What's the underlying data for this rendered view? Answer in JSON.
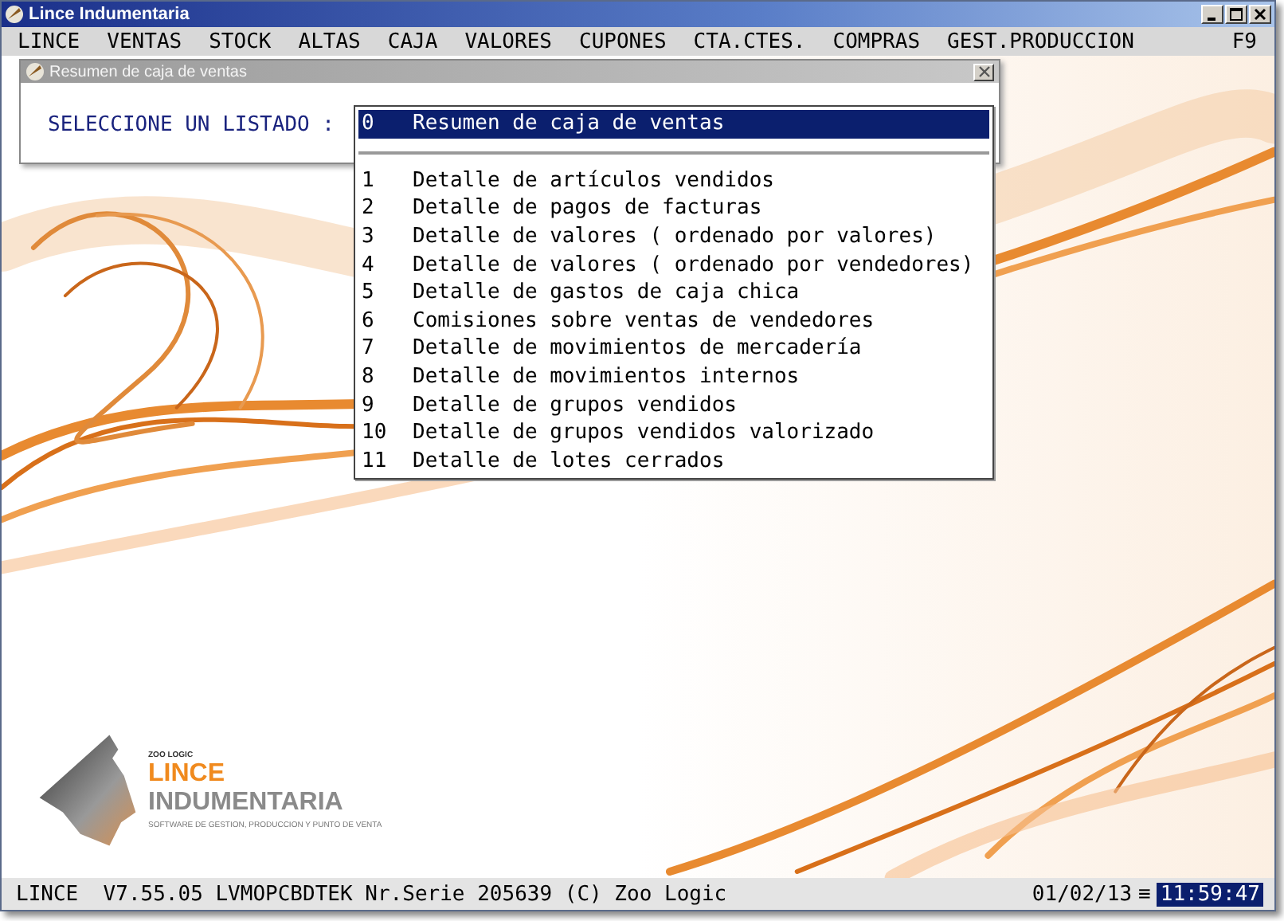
{
  "window": {
    "title": "Lince Indumentaria"
  },
  "menu": [
    {
      "label": "LINCE"
    },
    {
      "label": "VENTAS"
    },
    {
      "label": "STOCK"
    },
    {
      "label": "ALTAS"
    },
    {
      "label": "CAJA"
    },
    {
      "label": "VALORES"
    },
    {
      "label": "CUPONES"
    },
    {
      "label": "CTA.CTES."
    },
    {
      "label": "COMPRAS"
    },
    {
      "label": "GEST.PRODUCCION"
    }
  ],
  "menu_shortcut": "F9",
  "dialog": {
    "title": "Resumen de caja de ventas",
    "prompt": "SELECCIONE UN LISTADO :"
  },
  "listbox": {
    "items": [
      {
        "number": "0",
        "label": "Resumen de caja de ventas",
        "selected": true
      },
      {
        "number": "1",
        "label": "Detalle de artículos vendidos",
        "selected": false
      },
      {
        "number": "2",
        "label": "Detalle de pagos de facturas",
        "selected": false
      },
      {
        "number": "3",
        "label": "Detalle de valores ( ordenado por valores)",
        "selected": false
      },
      {
        "number": "4",
        "label": "Detalle de valores ( ordenado por vendedores)",
        "selected": false
      },
      {
        "number": "5",
        "label": "Detalle de gastos de caja chica",
        "selected": false
      },
      {
        "number": "6",
        "label": "Comisiones sobre ventas de vendedores",
        "selected": false
      },
      {
        "number": "7",
        "label": "Detalle de movimientos de mercadería",
        "selected": false
      },
      {
        "number": "8",
        "label": "Detalle de movimientos internos",
        "selected": false
      },
      {
        "number": "9",
        "label": "Detalle de grupos vendidos",
        "selected": false
      },
      {
        "number": "10",
        "label": "Detalle de grupos vendidos valorizado",
        "selected": false
      },
      {
        "number": "11",
        "label": "Detalle de lotes cerrados",
        "selected": false
      }
    ]
  },
  "logo": {
    "maker": "ZOO LOGIC",
    "name_line_1": "LINCE",
    "name_line_2": "INDUMENTARIA",
    "tagline": "SOFTWARE DE GESTION, PRODUCCION Y PUNTO DE VENTA"
  },
  "status_bar": {
    "info": "LINCE  V7.55.05 LVMOPCBDTEK Nr.Serie 205639 (C) Zoo Logic",
    "date": "01/02/13",
    "menu_glyph": "≡",
    "time": "11:59:47"
  }
}
